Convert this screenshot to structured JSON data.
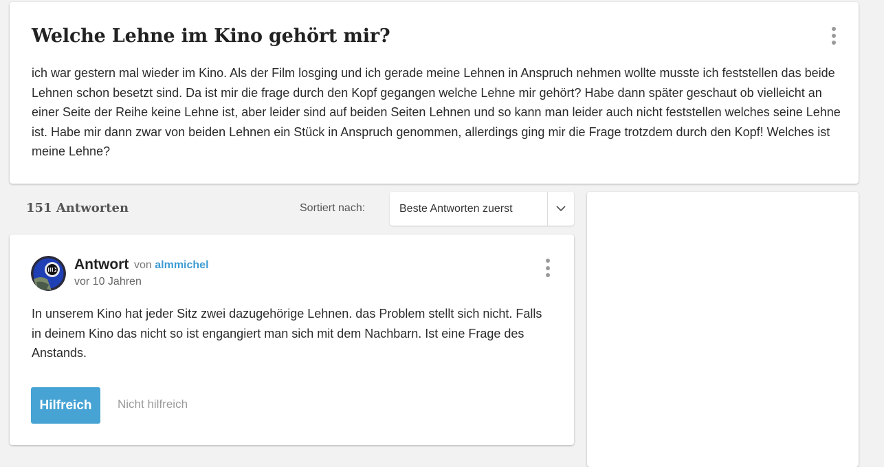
{
  "question": {
    "title": "Welche Lehne im Kino gehört mir?",
    "body": "ich war gestern mal wieder im Kino. Als der Film losging und ich gerade meine Lehnen in Anspruch nehmen wollte musste ich feststellen das beide Lehnen schon besetzt sind. Da ist mir die frage durch den Kopf gegangen welche Lehne mir gehört? Habe dann später geschaut ob vielleicht an einer Seite der Reihe keine Lehne ist, aber leider sind auf beiden Seiten Lehnen und so kann man leider auch nicht feststellen welches seine Lehne ist. Habe mir dann zwar von beiden Lehnen ein Stück in Anspruch genommen, allerdings ging mir die Frage trotzdem durch den Kopf! Welches ist meine Lehne?",
    "menu_icon": "more-vertical-icon"
  },
  "answers_header": {
    "count_label": "151 Antworten",
    "sort_label": "Sortiert nach:",
    "sort_value": "Beste Antworten zuerst",
    "sort_icon": "chevron-down-icon"
  },
  "answer": {
    "label": "Antwort",
    "by": "von",
    "author": "almmichel",
    "time": "vor 10 Jahren",
    "body": "In unserem Kino hat jeder Sitz zwei dazugehörige Lehnen. das Problem stellt sich nicht. Falls in deinem Kino das nicht so ist engangiert man sich mit dem Nachbarn. Ist eine Frage des Anstands.",
    "helpful_label": "Hilfreich",
    "not_helpful_label": "Nicht hilfreich",
    "menu_icon": "more-vertical-icon",
    "avatar_icon": "user-avatar"
  },
  "colors": {
    "accent": "#46a3d4",
    "link": "#3d9bd3",
    "background": "#f2f2f2"
  }
}
